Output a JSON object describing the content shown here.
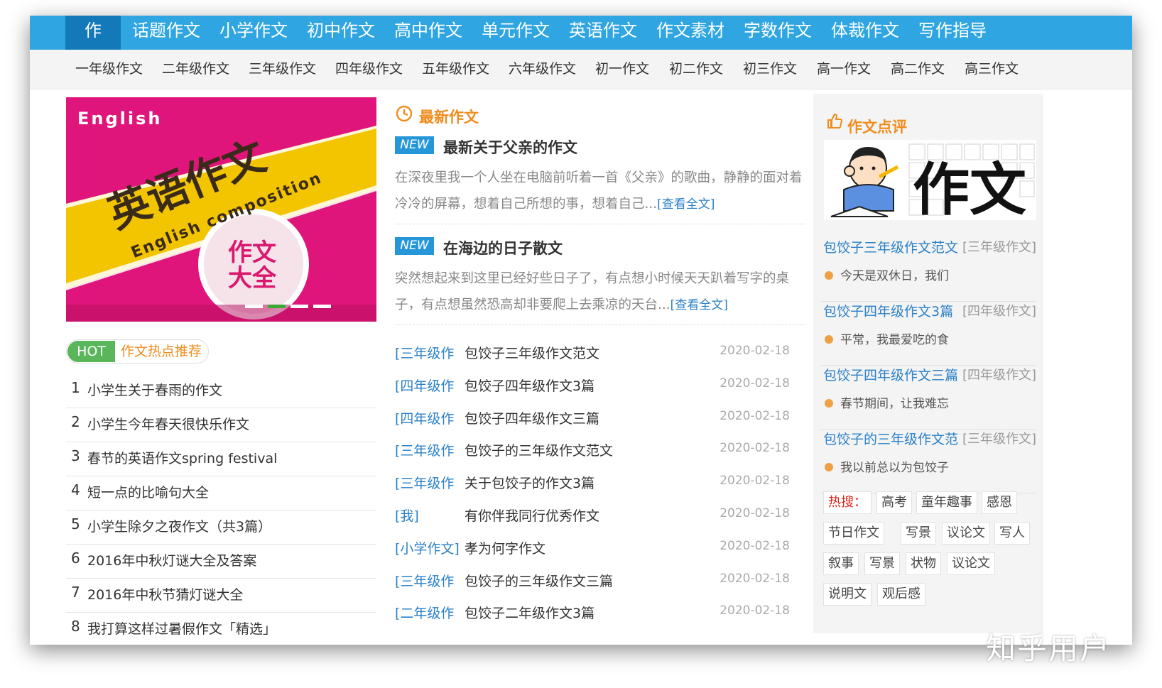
{
  "top_nav": [
    "作文",
    "话题作文",
    "小学作文",
    "初中作文",
    "高中作文",
    "单元作文",
    "英语作文",
    "作文素材",
    "字数作文",
    "体裁作文",
    "写作指导"
  ],
  "sub_nav": [
    "一年级作文",
    "二年级作文",
    "三年级作文",
    "四年级作文",
    "五年级作文",
    "六年级作文",
    "初一作文",
    "初二作文",
    "初三作文",
    "高一作文",
    "高二作文",
    "高三作文"
  ],
  "banner": {
    "english": "English",
    "title": "英语作文",
    "subtitle": "English composition",
    "stamp1": "作文",
    "stamp2": "大全",
    "active_slide": 2,
    "slides": 4
  },
  "hot": {
    "badge": "HOT",
    "title": "作文热点推荐",
    "items": [
      {
        "num": "1",
        "text": "小学生关于春雨的作文"
      },
      {
        "num": "2",
        "text": "小学生今年春天很快乐作文"
      },
      {
        "num": "3",
        "text": "春节的英语作文spring festival"
      },
      {
        "num": "4",
        "text": "短一点的比喻句大全"
      },
      {
        "num": "5",
        "text": "小学生除夕之夜作文（共3篇）"
      },
      {
        "num": "6",
        "text": "2016年中秋灯谜大全及答案"
      },
      {
        "num": "7",
        "text": "2016年中秋节猜灯谜大全"
      },
      {
        "num": "8",
        "text": "我打算这样过暑假作文「精选」"
      }
    ]
  },
  "latest": {
    "title": "最新作文",
    "new_label": "NEW",
    "more_label": "[查看全文]",
    "articles": [
      {
        "title": "最新关于父亲的作文",
        "excerpt": "在深夜里我一个人坐在电脑前听着一首《父亲》的歌曲，静静的面对着冷冷的屏幕，想着自己所想的事，想着自己..."
      },
      {
        "title": "在海边的日子散文",
        "excerpt": "突然想起来到这里已经好些日子了，有点想小时候天天趴着写字的桌子，有点想虽然恐高却非要爬上去乘凉的天台..."
      }
    ],
    "list": [
      {
        "cat": "[三年级作",
        "title": "包饺子三年级作文范文",
        "date": "2020-02-18"
      },
      {
        "cat": "[四年级作",
        "title": "包饺子四年级作文3篇",
        "date": "2020-02-18"
      },
      {
        "cat": "[四年级作",
        "title": "包饺子四年级作文三篇",
        "date": "2020-02-18"
      },
      {
        "cat": "[三年级作",
        "title": "包饺子的三年级作文范文",
        "date": "2020-02-18"
      },
      {
        "cat": "[三年级作",
        "title": "关于包饺子的作文3篇",
        "date": "2020-02-18"
      },
      {
        "cat": "[我]",
        "title": "有你伴我同行优秀作文",
        "date": "2020-02-18"
      },
      {
        "cat": "[小学作文]",
        "title": "孝为何字作文",
        "date": "2020-02-18"
      },
      {
        "cat": "[三年级作",
        "title": "包饺子的三年级作文三篇",
        "date": "2020-02-18"
      },
      {
        "cat": "[二年级作",
        "title": "包饺子二年级作文3篇",
        "date": "2020-02-18"
      }
    ]
  },
  "review": {
    "title": "作文点评",
    "image_text": "作文",
    "items": [
      {
        "title": "包饺子三年级作文范文",
        "cat": "[三年级作文]",
        "excerpt": "今天是双休日，我们"
      },
      {
        "title": "包饺子四年级作文3篇",
        "cat": "[四年级作文]",
        "excerpt": "平常，我最爱吃的食"
      },
      {
        "title": "包饺子四年级作文三篇",
        "cat": "[四年级作文]",
        "excerpt": "春节期间，让我难忘"
      },
      {
        "title": "包饺子的三年级作文范",
        "cat": "[三年级作文]",
        "excerpt": "我以前总以为包饺子"
      }
    ],
    "hot_label": "热搜：",
    "tags": [
      "高考",
      "童年趣事",
      "感恩",
      "节日作文",
      "写景",
      "议论文",
      "写人",
      "叙事",
      "写景",
      "状物",
      "议论文",
      "说明文",
      "观后感"
    ]
  },
  "watermark": "知乎用户",
  "colors": {
    "nav": "#2fa6e2",
    "nav_active": "#1479b9",
    "accent": "#f08c1c",
    "link": "#2a80c8",
    "hot_green": "#59b65b"
  }
}
